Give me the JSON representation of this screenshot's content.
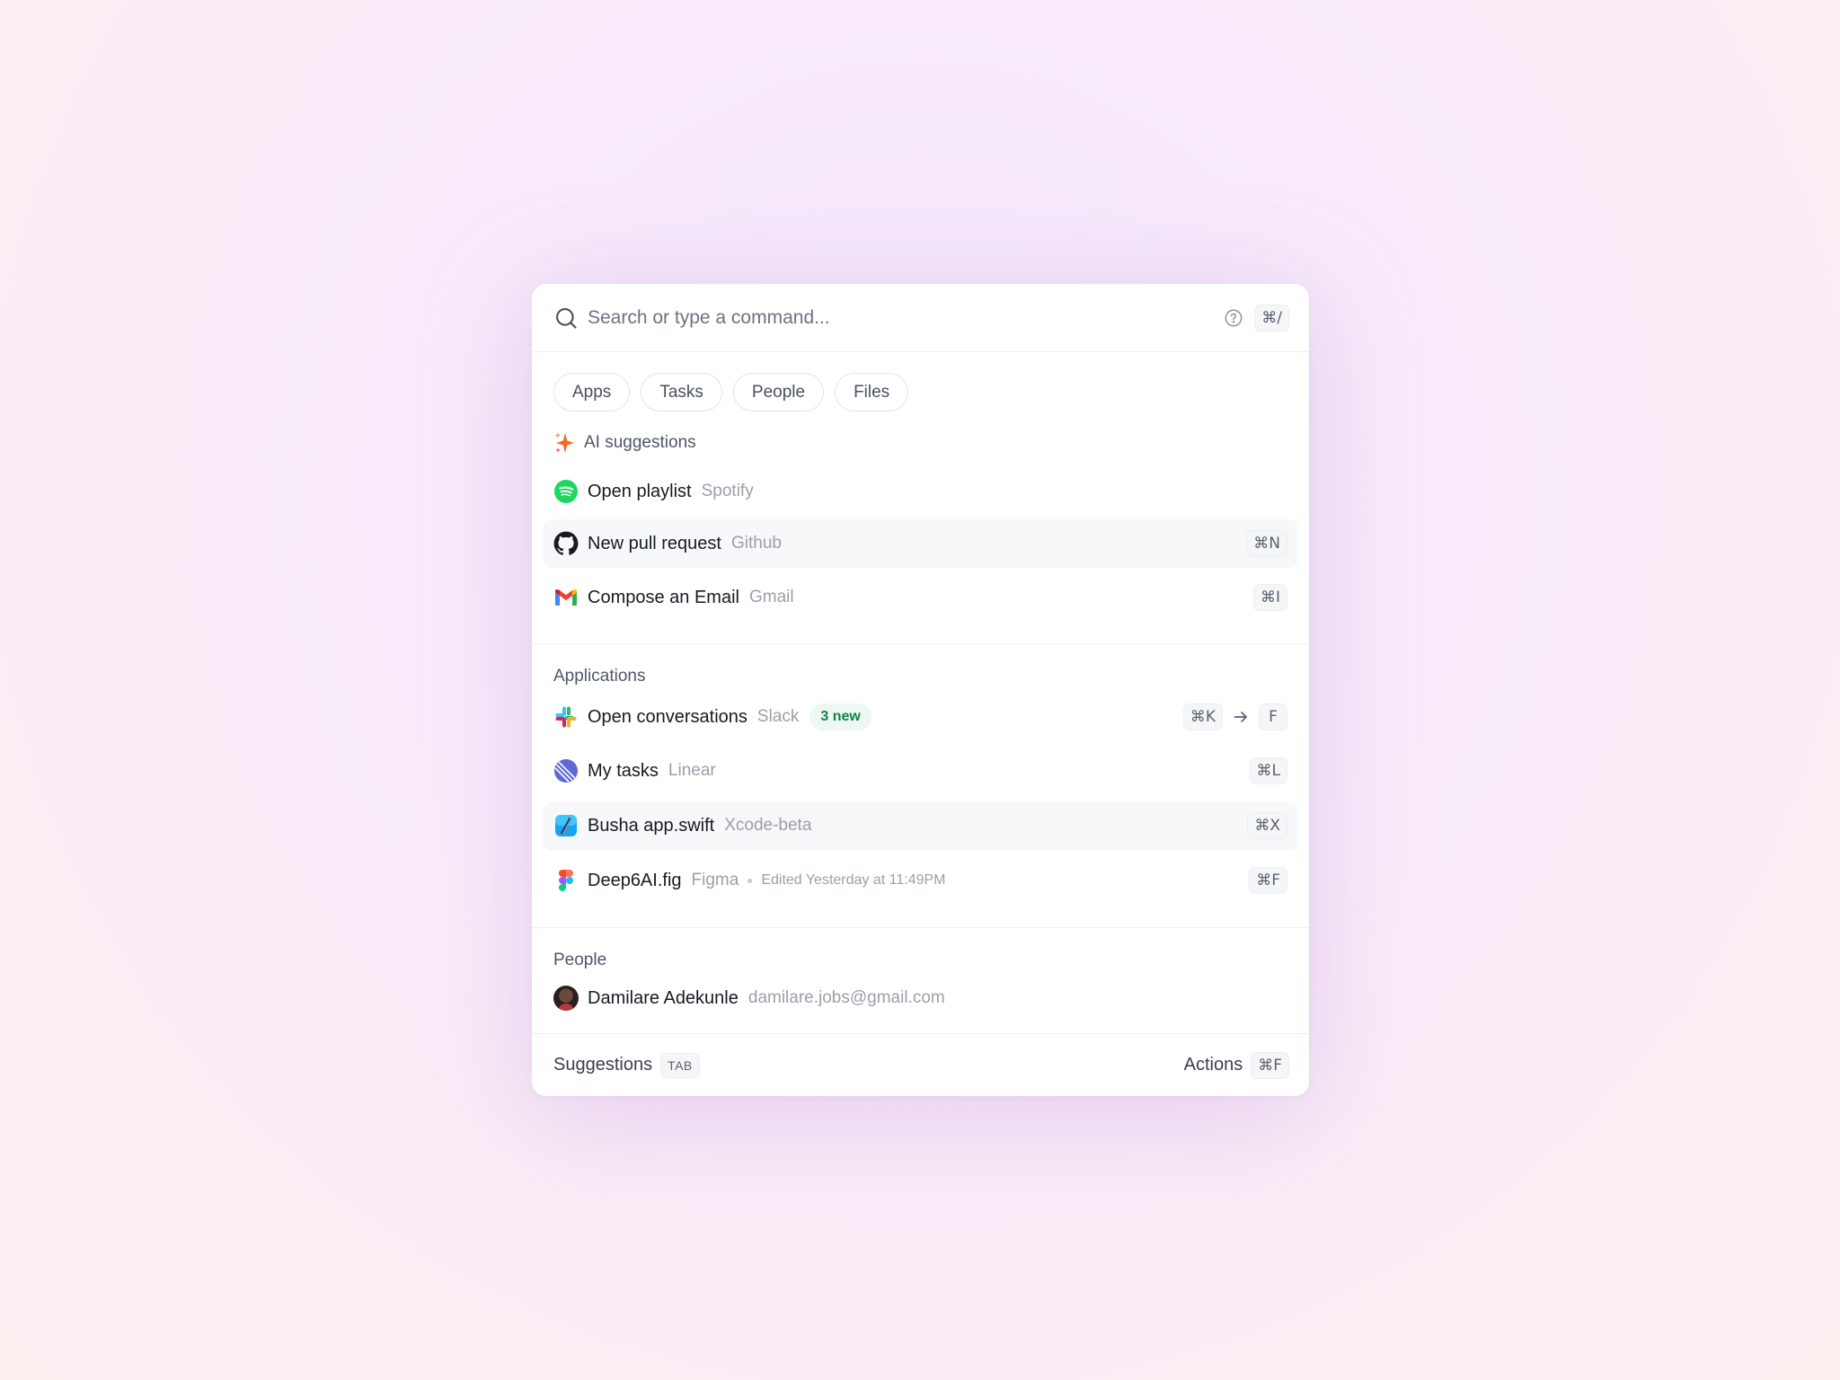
{
  "search": {
    "placeholder": "Search or type a command...",
    "shortcut": "⌘/"
  },
  "filters": [
    "Apps",
    "Tasks",
    "People",
    "Files"
  ],
  "ai_section": {
    "title": "AI suggestions",
    "items": [
      {
        "title": "Open playlist",
        "app": "Spotify",
        "icon": "spotify-icon"
      },
      {
        "title": "New pull request",
        "app": "Github",
        "icon": "github-icon",
        "shortcut": "⌘N"
      },
      {
        "title": "Compose an Email",
        "app": "Gmail",
        "icon": "gmail-icon",
        "shortcut": "⌘I"
      }
    ]
  },
  "apps_section": {
    "title": "Applications",
    "items": [
      {
        "title": "Open conversations",
        "app": "Slack",
        "icon": "slack-icon",
        "badge": "3 new",
        "shortcut": "⌘K",
        "shortcut2": "F"
      },
      {
        "title": "My tasks",
        "app": "Linear",
        "icon": "linear-icon",
        "shortcut": "⌘L"
      },
      {
        "title": "Busha app.swift",
        "app": "Xcode-beta",
        "icon": "xcode-icon",
        "shortcut": "⌘X"
      },
      {
        "title": "Deep6AI.fig",
        "app": "Figma",
        "icon": "figma-icon",
        "meta": "Edited Yesterday at 11:49PM",
        "shortcut": "⌘F"
      }
    ]
  },
  "people_section": {
    "title": "People",
    "items": [
      {
        "name": "Damilare Adekunle",
        "email": "damilare.jobs@gmail.com"
      }
    ]
  },
  "footer": {
    "left_label": "Suggestions",
    "left_key": "TAB",
    "right_label": "Actions",
    "right_key": "⌘F"
  }
}
